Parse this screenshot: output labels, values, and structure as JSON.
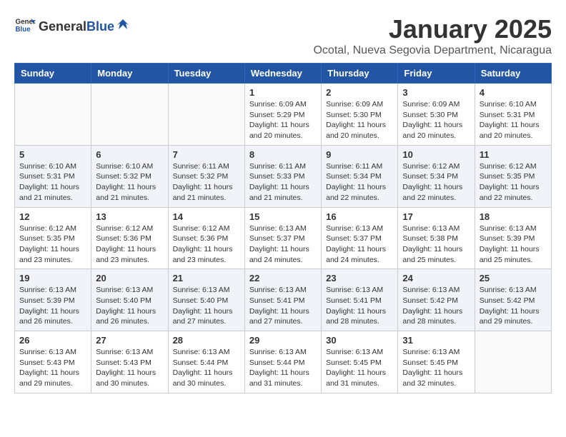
{
  "header": {
    "logo_general": "General",
    "logo_blue": "Blue",
    "month_title": "January 2025",
    "location": "Ocotal, Nueva Segovia Department, Nicaragua"
  },
  "weekdays": [
    "Sunday",
    "Monday",
    "Tuesday",
    "Wednesday",
    "Thursday",
    "Friday",
    "Saturday"
  ],
  "weeks": [
    [
      {
        "day": "",
        "content": ""
      },
      {
        "day": "",
        "content": ""
      },
      {
        "day": "",
        "content": ""
      },
      {
        "day": "1",
        "content": "Sunrise: 6:09 AM\nSunset: 5:29 PM\nDaylight: 11 hours and 20 minutes."
      },
      {
        "day": "2",
        "content": "Sunrise: 6:09 AM\nSunset: 5:30 PM\nDaylight: 11 hours and 20 minutes."
      },
      {
        "day": "3",
        "content": "Sunrise: 6:09 AM\nSunset: 5:30 PM\nDaylight: 11 hours and 20 minutes."
      },
      {
        "day": "4",
        "content": "Sunrise: 6:10 AM\nSunset: 5:31 PM\nDaylight: 11 hours and 20 minutes."
      }
    ],
    [
      {
        "day": "5",
        "content": "Sunrise: 6:10 AM\nSunset: 5:31 PM\nDaylight: 11 hours and 21 minutes."
      },
      {
        "day": "6",
        "content": "Sunrise: 6:10 AM\nSunset: 5:32 PM\nDaylight: 11 hours and 21 minutes."
      },
      {
        "day": "7",
        "content": "Sunrise: 6:11 AM\nSunset: 5:32 PM\nDaylight: 11 hours and 21 minutes."
      },
      {
        "day": "8",
        "content": "Sunrise: 6:11 AM\nSunset: 5:33 PM\nDaylight: 11 hours and 21 minutes."
      },
      {
        "day": "9",
        "content": "Sunrise: 6:11 AM\nSunset: 5:34 PM\nDaylight: 11 hours and 22 minutes."
      },
      {
        "day": "10",
        "content": "Sunrise: 6:12 AM\nSunset: 5:34 PM\nDaylight: 11 hours and 22 minutes."
      },
      {
        "day": "11",
        "content": "Sunrise: 6:12 AM\nSunset: 5:35 PM\nDaylight: 11 hours and 22 minutes."
      }
    ],
    [
      {
        "day": "12",
        "content": "Sunrise: 6:12 AM\nSunset: 5:35 PM\nDaylight: 11 hours and 23 minutes."
      },
      {
        "day": "13",
        "content": "Sunrise: 6:12 AM\nSunset: 5:36 PM\nDaylight: 11 hours and 23 minutes."
      },
      {
        "day": "14",
        "content": "Sunrise: 6:12 AM\nSunset: 5:36 PM\nDaylight: 11 hours and 23 minutes."
      },
      {
        "day": "15",
        "content": "Sunrise: 6:13 AM\nSunset: 5:37 PM\nDaylight: 11 hours and 24 minutes."
      },
      {
        "day": "16",
        "content": "Sunrise: 6:13 AM\nSunset: 5:37 PM\nDaylight: 11 hours and 24 minutes."
      },
      {
        "day": "17",
        "content": "Sunrise: 6:13 AM\nSunset: 5:38 PM\nDaylight: 11 hours and 25 minutes."
      },
      {
        "day": "18",
        "content": "Sunrise: 6:13 AM\nSunset: 5:39 PM\nDaylight: 11 hours and 25 minutes."
      }
    ],
    [
      {
        "day": "19",
        "content": "Sunrise: 6:13 AM\nSunset: 5:39 PM\nDaylight: 11 hours and 26 minutes."
      },
      {
        "day": "20",
        "content": "Sunrise: 6:13 AM\nSunset: 5:40 PM\nDaylight: 11 hours and 26 minutes."
      },
      {
        "day": "21",
        "content": "Sunrise: 6:13 AM\nSunset: 5:40 PM\nDaylight: 11 hours and 27 minutes."
      },
      {
        "day": "22",
        "content": "Sunrise: 6:13 AM\nSunset: 5:41 PM\nDaylight: 11 hours and 27 minutes."
      },
      {
        "day": "23",
        "content": "Sunrise: 6:13 AM\nSunset: 5:41 PM\nDaylight: 11 hours and 28 minutes."
      },
      {
        "day": "24",
        "content": "Sunrise: 6:13 AM\nSunset: 5:42 PM\nDaylight: 11 hours and 28 minutes."
      },
      {
        "day": "25",
        "content": "Sunrise: 6:13 AM\nSunset: 5:42 PM\nDaylight: 11 hours and 29 minutes."
      }
    ],
    [
      {
        "day": "26",
        "content": "Sunrise: 6:13 AM\nSunset: 5:43 PM\nDaylight: 11 hours and 29 minutes."
      },
      {
        "day": "27",
        "content": "Sunrise: 6:13 AM\nSunset: 5:43 PM\nDaylight: 11 hours and 30 minutes."
      },
      {
        "day": "28",
        "content": "Sunrise: 6:13 AM\nSunset: 5:44 PM\nDaylight: 11 hours and 30 minutes."
      },
      {
        "day": "29",
        "content": "Sunrise: 6:13 AM\nSunset: 5:44 PM\nDaylight: 11 hours and 31 minutes."
      },
      {
        "day": "30",
        "content": "Sunrise: 6:13 AM\nSunset: 5:45 PM\nDaylight: 11 hours and 31 minutes."
      },
      {
        "day": "31",
        "content": "Sunrise: 6:13 AM\nSunset: 5:45 PM\nDaylight: 11 hours and 32 minutes."
      },
      {
        "day": "",
        "content": ""
      }
    ]
  ]
}
